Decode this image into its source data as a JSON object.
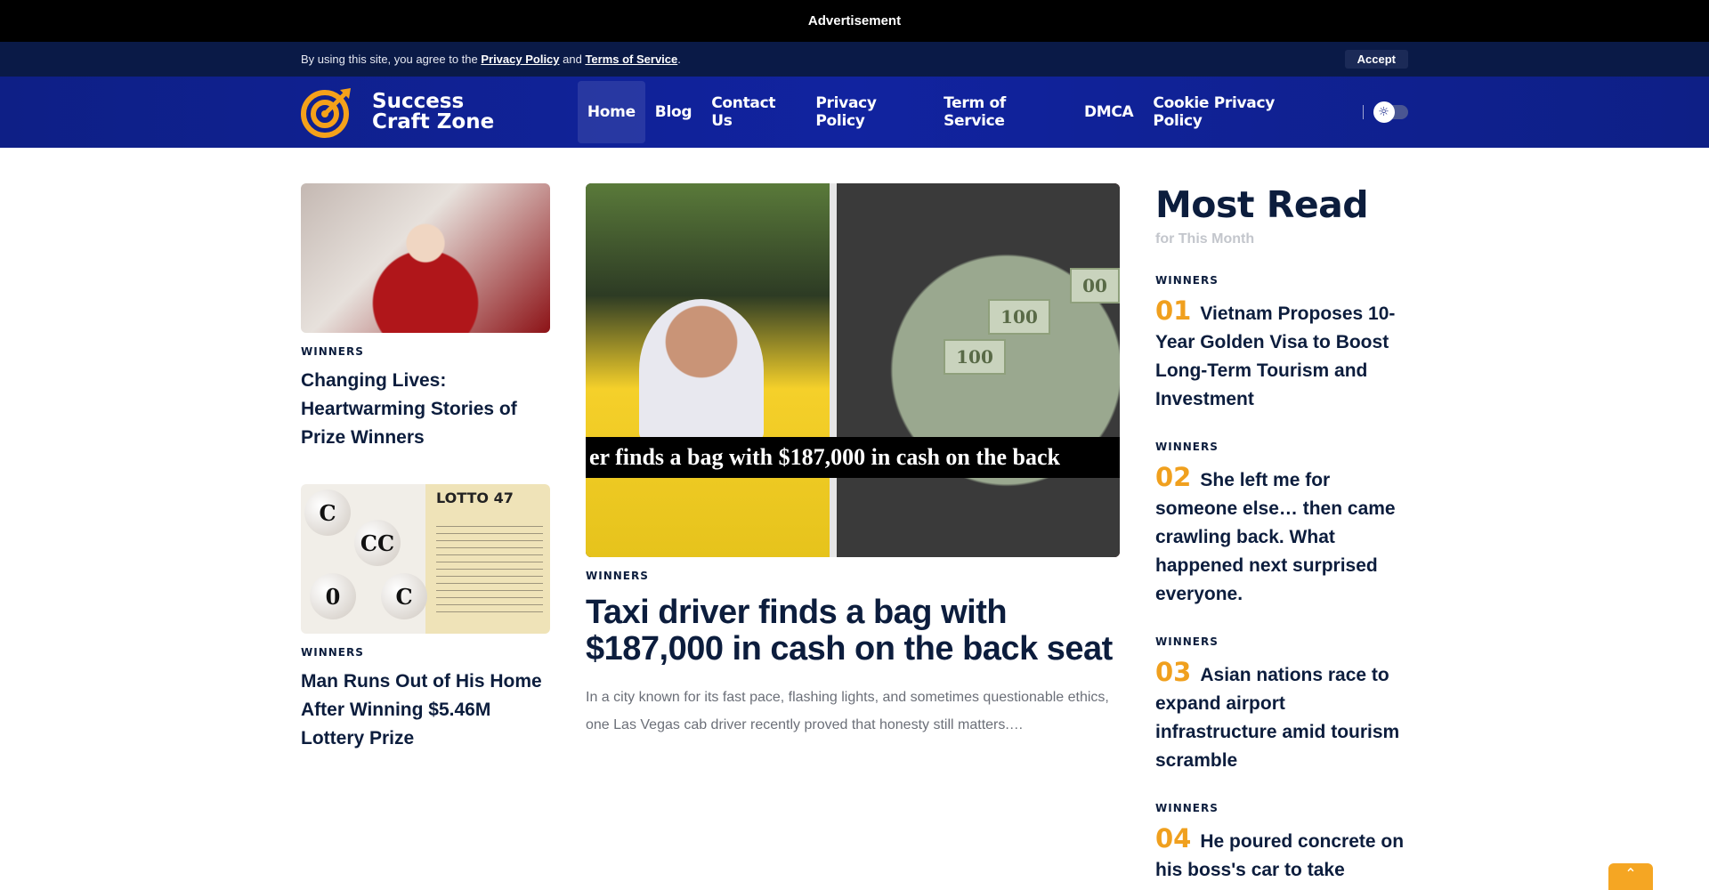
{
  "ad": {
    "label": "Advertisement"
  },
  "consent": {
    "prefix": "By using this site, you agree to the ",
    "privacy_link": "Privacy Policy",
    "middle": " and ",
    "terms_link": "Terms of Service",
    "suffix": ".",
    "accept_label": "Accept"
  },
  "header": {
    "logo_line1": "Success",
    "logo_line2": "Craft Zone",
    "nav": [
      "Home",
      "Blog",
      "Contact Us",
      "Privacy Policy",
      "Term of Service",
      "DMCA",
      "Cookie Privacy Policy"
    ],
    "active_nav": "Home",
    "theme_icon": "sun-icon"
  },
  "left_cards": [
    {
      "category": "WINNERS",
      "title": "Changing Lives: Heartwarming Stories of Prize Winners"
    },
    {
      "category": "WINNERS",
      "title": "Man Runs Out of His Home After Winning $5.46M Lottery Prize"
    }
  ],
  "left_card_2_image": {
    "ticket_title": "LOTTO 47",
    "balls": [
      "C",
      "CC",
      "0",
      "C"
    ]
  },
  "hero": {
    "caption": "er finds a bag with $187,000 in cash on the back",
    "bills": [
      "100",
      "100",
      "00"
    ],
    "category": "WINNERS",
    "title": "Taxi driver finds a bag with $187,000 in cash on the back seat",
    "excerpt": "In a city known for its fast pace, flashing lights, and sometimes questionable ethics, one Las Vegas cab driver recently proved that honesty still matters.…"
  },
  "most_read": {
    "title": "Most Read",
    "subtitle": "for This Month",
    "items": [
      {
        "category": "WINNERS",
        "num": "01",
        "text": "Vietnam Proposes 10-Year Golden Visa to Boost Long-Term Tourism and Investment"
      },
      {
        "category": "WINNERS",
        "num": "02",
        "text": "She left me for someone else… then came crawling back. What happened next surprised everyone."
      },
      {
        "category": "WINNERS",
        "num": "03",
        "text": "Asian nations race to expand airport infrastructure amid tourism scramble"
      },
      {
        "category": "WINNERS",
        "num": "04",
        "text": "He poured concrete on his boss's car to take"
      }
    ]
  },
  "colors": {
    "accent": "#f0a01e",
    "header_bg": "#11239f",
    "text_dark": "#0c1d3d"
  },
  "scroll_icon": "chevron-up-icon"
}
